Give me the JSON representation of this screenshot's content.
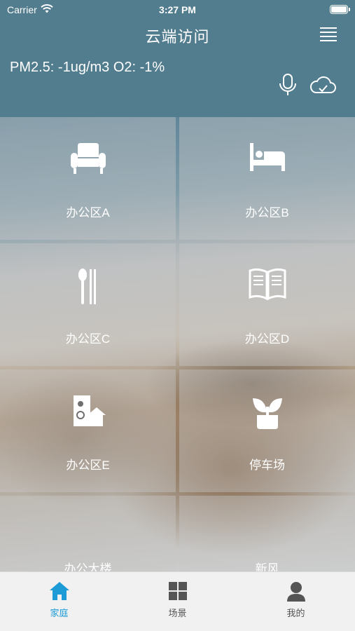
{
  "status_bar": {
    "carrier": "Carrier",
    "time": "3:27 PM"
  },
  "header": {
    "title": "云端访问",
    "air_quality": "PM2.5: -1ug/m3 O2: -1%"
  },
  "tiles": [
    {
      "label": "办公区A",
      "icon": "armchair-icon"
    },
    {
      "label": "办公区B",
      "icon": "bed-icon"
    },
    {
      "label": "办公区C",
      "icon": "utensils-icon"
    },
    {
      "label": "办公区D",
      "icon": "book-icon"
    },
    {
      "label": "办公区E",
      "icon": "door-house-icon"
    },
    {
      "label": "停车场",
      "icon": "plant-pot-icon"
    },
    {
      "label": "办公大楼",
      "icon": ""
    },
    {
      "label": "新风",
      "icon": ""
    }
  ],
  "tabbar": {
    "tabs": [
      {
        "label": "家庭",
        "icon": "home-icon",
        "active": true
      },
      {
        "label": "场景",
        "icon": "grid-icon",
        "active": false
      },
      {
        "label": "我的",
        "icon": "user-icon",
        "active": false
      }
    ]
  },
  "colors": {
    "header_bg": "#527d8e",
    "active_tab": "#1c9bd7",
    "tab_inactive": "#555555"
  }
}
